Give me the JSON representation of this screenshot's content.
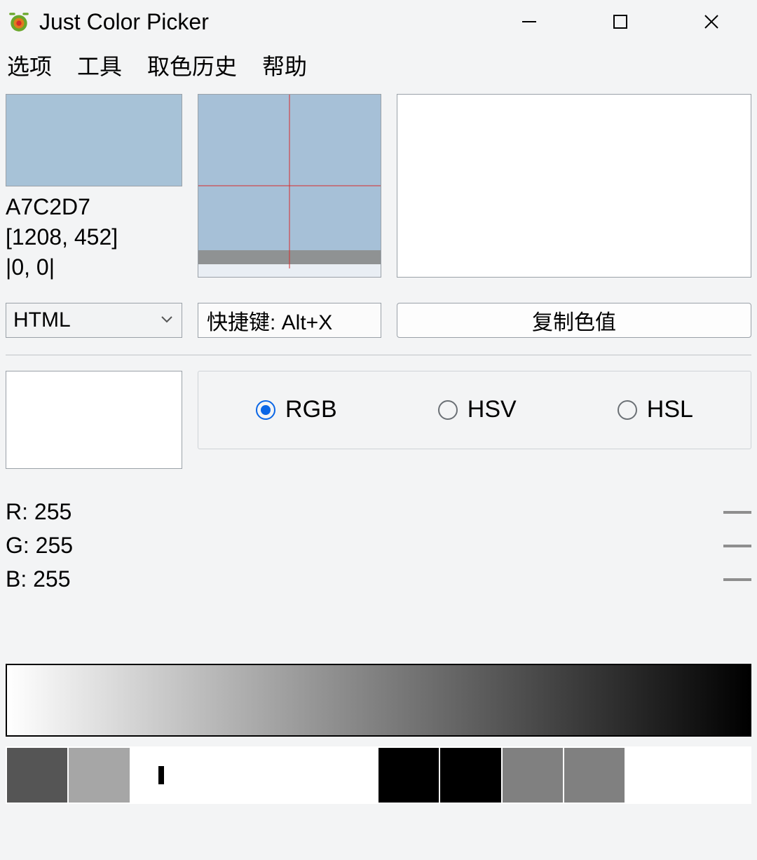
{
  "window": {
    "title": "Just Color Picker"
  },
  "menu": {
    "options": "选项",
    "tools": "工具",
    "history": "取色历史",
    "help": "帮助"
  },
  "picked": {
    "hex": "A7C2D7",
    "coords": "[1208, 452]",
    "delta": "|0, 0|",
    "swatch_color": "#A7C2D7"
  },
  "format_combo": {
    "selected": "HTML"
  },
  "hotkey_field": {
    "value": "快捷键: Alt+X"
  },
  "copy_button": {
    "label": "复制色值"
  },
  "modes": {
    "rgb": "RGB",
    "hsv": "HSV",
    "hsl": "HSL",
    "selected": "rgb"
  },
  "channels": {
    "r_label": "R: 255",
    "g_label": "G: 255",
    "b_label": "B: 255",
    "r": 255,
    "g": 255,
    "b": 255
  },
  "edit_swatch_color": "#FFFFFF",
  "palette": [
    "#555555",
    "#A6A6A6",
    "#FFFFFF",
    "#FFFFFF",
    "#FFFFFF",
    "#FFFFFF",
    "#000000",
    "#000000",
    "#808080",
    "#808080",
    "#FFFFFF",
    "#FFFFFF"
  ],
  "palette_cursor_index": 2
}
